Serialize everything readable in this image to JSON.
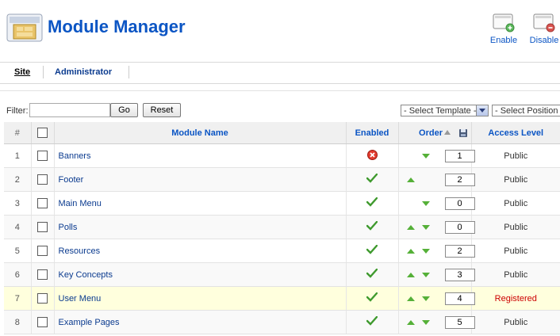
{
  "header": {
    "title": "Module Manager",
    "logo_icon": "module-icon",
    "actions": [
      {
        "label": "Enable",
        "icon": "enable-icon",
        "accent": "#5cb85c"
      },
      {
        "label": "Disable",
        "icon": "disable-icon",
        "accent": "#d9534f"
      }
    ]
  },
  "subnav": {
    "tabs": [
      {
        "label": "Site",
        "active": true
      },
      {
        "label": "Administrator",
        "active": false
      }
    ]
  },
  "filter": {
    "label": "Filter:",
    "value": "",
    "go_label": "Go",
    "reset_label": "Reset",
    "template_select": "- Select Template -",
    "position_select": "- Select Position -"
  },
  "table": {
    "headers": {
      "num": "#",
      "name": "Module Name",
      "enabled": "Enabled",
      "order": "Order",
      "access": "Access Level"
    },
    "rows": [
      {
        "num": "1",
        "name": "Banners",
        "enabled": false,
        "up": false,
        "down": true,
        "order": "1",
        "access": "Public"
      },
      {
        "num": "2",
        "name": "Footer",
        "enabled": true,
        "up": true,
        "down": false,
        "order": "2",
        "access": "Public"
      },
      {
        "num": "3",
        "name": "Main Menu",
        "enabled": true,
        "up": false,
        "down": true,
        "order": "0",
        "access": "Public"
      },
      {
        "num": "4",
        "name": "Polls",
        "enabled": true,
        "up": true,
        "down": true,
        "order": "0",
        "access": "Public"
      },
      {
        "num": "5",
        "name": "Resources",
        "enabled": true,
        "up": true,
        "down": true,
        "order": "2",
        "access": "Public"
      },
      {
        "num": "6",
        "name": "Key Concepts",
        "enabled": true,
        "up": true,
        "down": true,
        "order": "3",
        "access": "Public"
      },
      {
        "num": "7",
        "name": "User Menu",
        "enabled": true,
        "up": true,
        "down": true,
        "order": "4",
        "access": "Registered",
        "highlight": true
      },
      {
        "num": "8",
        "name": "Example Pages",
        "enabled": true,
        "up": true,
        "down": true,
        "order": "5",
        "access": "Public"
      }
    ]
  },
  "colors": {
    "link": "#0b55c4",
    "public": "#008000",
    "registered": "#cc0000",
    "arrow": "#55b038",
    "highlight_row": "#ffffdd"
  }
}
